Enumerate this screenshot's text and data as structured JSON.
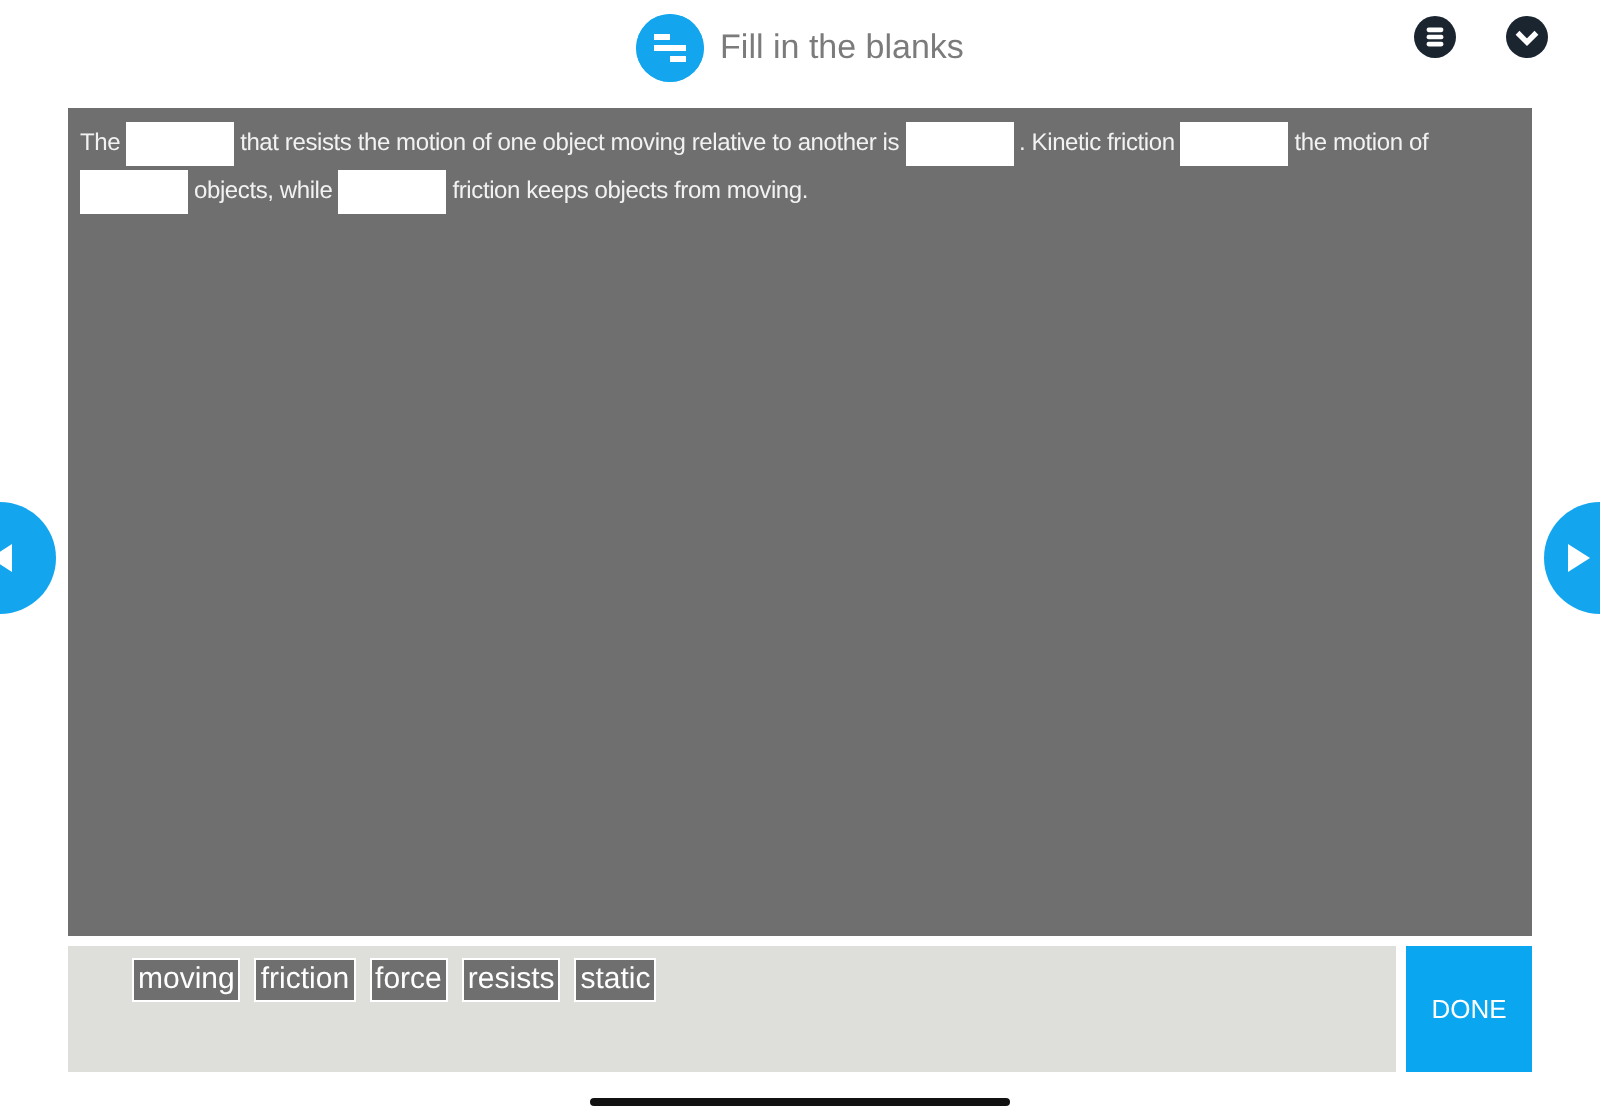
{
  "header": {
    "title": "Fill in the blanks"
  },
  "passage": [
    {
      "kind": "text",
      "text": "The"
    },
    {
      "kind": "blank"
    },
    {
      "kind": "text",
      "text": "that resists the motion of one object moving relative to another is"
    },
    {
      "kind": "blank"
    },
    {
      "kind": "text",
      "text": ". Kinetic friction"
    },
    {
      "kind": "blank"
    },
    {
      "kind": "text",
      "text": "the motion of"
    },
    {
      "kind": "blank"
    },
    {
      "kind": "text",
      "text": "objects, while"
    },
    {
      "kind": "blank"
    },
    {
      "kind": "text",
      "text": "friction keeps objects from moving."
    }
  ],
  "word_bank": [
    "moving",
    "friction",
    "force",
    "resists",
    "static"
  ],
  "done_button": "DONE"
}
